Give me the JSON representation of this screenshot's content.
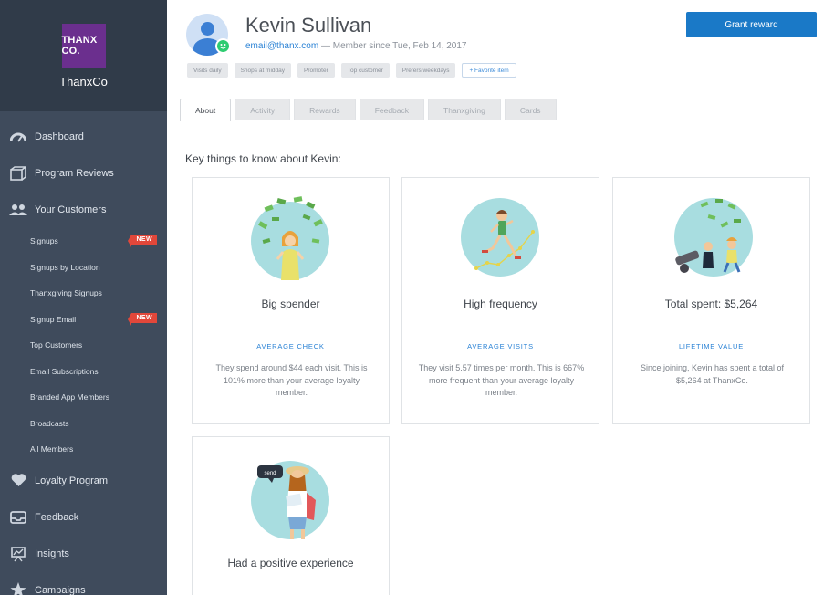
{
  "brand": {
    "logo_text": "THANX CO.",
    "name": "ThanxCo"
  },
  "nav": {
    "dashboard": "Dashboard",
    "program_reviews": "Program Reviews",
    "your_customers": "Your Customers",
    "sub": [
      {
        "label": "Signups",
        "badge": "NEW"
      },
      {
        "label": "Signups by Location"
      },
      {
        "label": "Thanxgiving Signups"
      },
      {
        "label": "Signup Email",
        "badge": "NEW"
      },
      {
        "label": "Top Customers"
      },
      {
        "label": "Email Subscriptions"
      },
      {
        "label": "Branded App Members"
      },
      {
        "label": "Broadcasts"
      },
      {
        "label": "All Members"
      }
    ],
    "loyalty_program": "Loyalty Program",
    "feedback": "Feedback",
    "insights": "Insights",
    "campaigns": "Campaigns"
  },
  "customer": {
    "name": "Kevin Sullivan",
    "email": "email@thanx.com",
    "member_since": "— Member since Tue, Feb 14, 2017",
    "tags": [
      "Visits daily",
      "Shops at midday",
      "Promoter",
      "Top customer",
      "Prefers weekdays"
    ],
    "add_tag": "+ Favorite item"
  },
  "grant_reward_label": "Grant reward",
  "tabs": [
    "About",
    "Activity",
    "Rewards",
    "Feedback",
    "Thanxgiving",
    "Cards"
  ],
  "section_title": "Key things to know about Kevin:",
  "cards": [
    {
      "title": "Big spender",
      "subtitle": "AVERAGE CHECK",
      "desc": "They spend around $44 each visit. This is 101% more than your average loyalty member."
    },
    {
      "title": "High frequency",
      "subtitle": "AVERAGE VISITS",
      "desc": "They visit 5.57 times per month. This is 667% more frequent than your average loyalty member."
    },
    {
      "title": "Total spent: $5,264",
      "subtitle": "LIFETIME VALUE",
      "desc": "Since joining, Kevin has spent a total of $5,264 at ThanxCo."
    },
    {
      "title": "Had a positive experience",
      "bubble": "send"
    }
  ],
  "colors": {
    "sidebar": "#3f4b5c",
    "brand_bg": "#303b49",
    "accent": "#1a79c7",
    "badge": "#e2473a",
    "illustration_circle": "#a8dde0"
  }
}
